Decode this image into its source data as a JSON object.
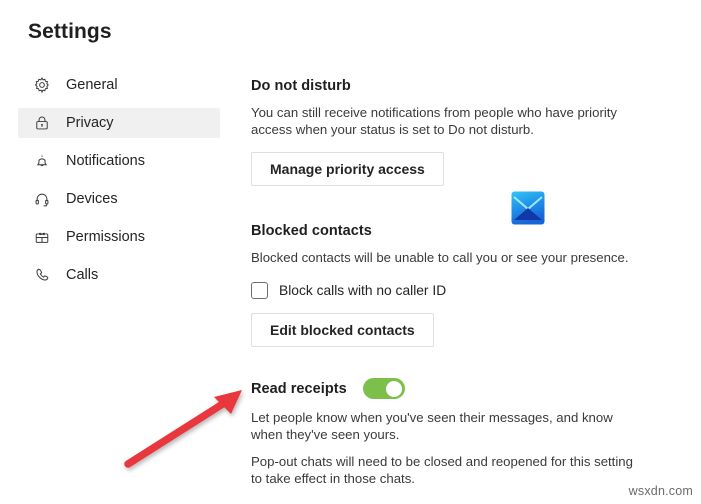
{
  "window": {
    "title": "Settings"
  },
  "sidebar": {
    "items": [
      {
        "label": "General",
        "icon": "gear-icon",
        "active": false
      },
      {
        "label": "Privacy",
        "icon": "lock-icon",
        "active": true
      },
      {
        "label": "Notifications",
        "icon": "bell-icon",
        "active": false
      },
      {
        "label": "Devices",
        "icon": "headset-icon",
        "active": false
      },
      {
        "label": "Permissions",
        "icon": "permissions-icon",
        "active": false
      },
      {
        "label": "Calls",
        "icon": "phone-icon",
        "active": false
      }
    ]
  },
  "main": {
    "do_not_disturb": {
      "heading": "Do not disturb",
      "description": "You can still receive notifications from people who have priority access when your status is set to Do not disturb.",
      "button_label": "Manage priority access"
    },
    "blocked_contacts": {
      "heading": "Blocked contacts",
      "description": "Blocked contacts will be unable to call you or see your presence.",
      "checkbox_label": "Block calls with no caller ID",
      "checkbox_checked": false,
      "button_label": "Edit blocked contacts"
    },
    "read_receipts": {
      "heading": "Read receipts",
      "toggle_on": true,
      "description_1": "Let people know when you've seen their messages, and know when they've seen yours.",
      "description_2": "Pop-out chats will need to be closed and reopened for this setting to take effect in those chats."
    }
  },
  "overlay": {
    "envelope_icon": "mail-envelope-icon",
    "arrow_annotation": "red-arrow-pointing-to-read-receipts",
    "watermark": "wsxdn.com"
  },
  "colors": {
    "toggle_on": "#7cc04b",
    "active_nav_background": "#f0f0f0",
    "annotation_red": "#e8393c",
    "envelope_blue": "#1a5fd0",
    "envelope_cyan": "#27c0f0"
  }
}
